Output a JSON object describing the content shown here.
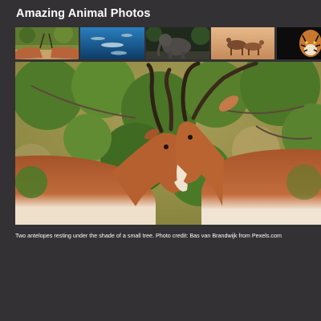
{
  "gallery": {
    "title": "Amazing Animal Photos",
    "thumbnails": [
      {
        "icon": "antelopes-thumbnail",
        "alt": "Two antelopes"
      },
      {
        "icon": "dolphins-thumbnail",
        "alt": "Dolphins underwater"
      },
      {
        "icon": "elephant-thumbnail",
        "alt": "Elephant"
      },
      {
        "icon": "horses-thumbnail",
        "alt": "Horses"
      },
      {
        "icon": "tiger-thumbnail",
        "alt": "Tiger"
      }
    ],
    "selected_index": 0,
    "caption": "Two antelopes resting under the shade of a small tree. Photo credit: Bas van Brandwijk from Pexels.com"
  },
  "colors": {
    "background": "#333133",
    "text": "#ffffff"
  }
}
